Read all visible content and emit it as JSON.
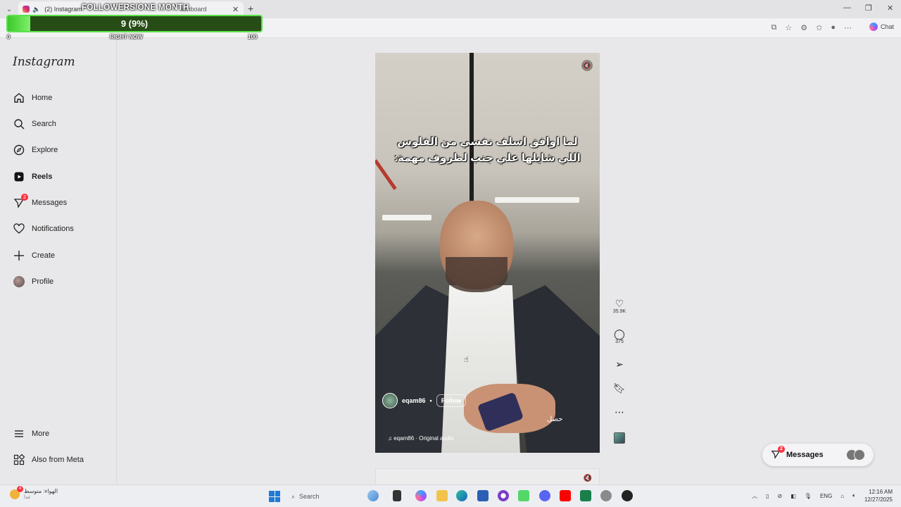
{
  "browser": {
    "tab_title": "(2) Instagram",
    "tab2_title": "ashboard",
    "chat_label": "Chat"
  },
  "overlay": {
    "title": "FOLLOWERS/ONE MONTH",
    "value_text": "9 (9%)",
    "progress_percent": 9,
    "min_label": "0",
    "mid_label": "RIGHT NOW",
    "max_label": "100"
  },
  "sidebar": {
    "logo": "Instagram",
    "items": [
      {
        "label": "Home",
        "icon": "home-icon"
      },
      {
        "label": "Search",
        "icon": "search-icon"
      },
      {
        "label": "Explore",
        "icon": "compass-icon"
      },
      {
        "label": "Reels",
        "icon": "reels-icon"
      },
      {
        "label": "Messages",
        "icon": "messenger-icon",
        "badge": "2"
      },
      {
        "label": "Notifications",
        "icon": "heart-icon"
      },
      {
        "label": "Create",
        "icon": "plus-icon"
      },
      {
        "label": "Profile",
        "icon": "avatar-icon"
      }
    ],
    "more_label": "More",
    "meta_label": "Also from Meta"
  },
  "reel": {
    "caption_line1": "لما اوافق اسلف نفسي من الفلوس",
    "caption_line2": "اللي شايلها علي جنب لظروف مهمة:",
    "username": "eqam86",
    "follow_label": "Follow",
    "subtitle": "حصل",
    "audio": "eqam86 · Original audio",
    "likes": "35.9K",
    "comments": "375"
  },
  "messages_pill": {
    "label": "Messages",
    "badge": "2"
  },
  "taskbar": {
    "weather_line1": "الهواء: متوسط",
    "weather_line2": "غدا",
    "weather_badge": "4",
    "search_placeholder": "Search",
    "lang": "ENG",
    "time": "12:16 AM",
    "date": "12/27/2025"
  }
}
